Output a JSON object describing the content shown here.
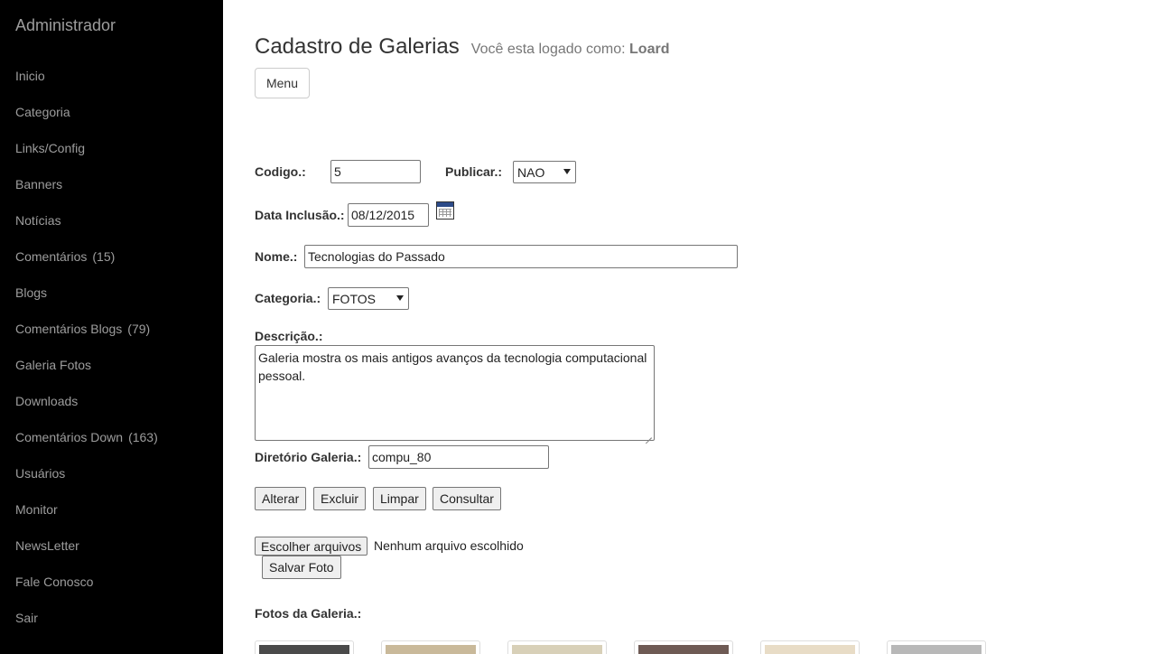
{
  "sidebar": {
    "brand": "Administrador",
    "items": [
      {
        "label": "Inicio",
        "badge": ""
      },
      {
        "label": "Categoria",
        "badge": ""
      },
      {
        "label": "Links/Config",
        "badge": ""
      },
      {
        "label": "Banners",
        "badge": ""
      },
      {
        "label": "Notícias",
        "badge": ""
      },
      {
        "label": "Comentários",
        "badge": "(15)"
      },
      {
        "label": "Blogs",
        "badge": ""
      },
      {
        "label": "Comentários Blogs",
        "badge": "(79)"
      },
      {
        "label": "Galeria Fotos",
        "badge": ""
      },
      {
        "label": "Downloads",
        "badge": ""
      },
      {
        "label": "Comentários Down",
        "badge": "(163)"
      },
      {
        "label": "Usuários",
        "badge": ""
      },
      {
        "label": "Monitor",
        "badge": ""
      },
      {
        "label": "NewsLetter",
        "badge": ""
      },
      {
        "label": "Fale Conosco",
        "badge": ""
      },
      {
        "label": "Sair",
        "badge": ""
      }
    ]
  },
  "header": {
    "title": "Cadastro de Galerias",
    "logged_prefix": "Você esta logado como:",
    "user": "Loard",
    "menu_label": "Menu"
  },
  "form": {
    "codigo_label": "Codigo.:",
    "codigo_value": "5",
    "publicar_label": "Publicar.:",
    "publicar_value": "NAO",
    "data_label": "Data Inclusão.:",
    "data_value": "08/12/2015",
    "calendar_icon": "calendar-icon",
    "nome_label": "Nome.:",
    "nome_value": "Tecnologias do Passado",
    "categoria_label": "Categoria.:",
    "categoria_value": "FOTOS",
    "descricao_label": "Descrição.:",
    "descricao_value": "Galeria mostra os mais antigos avanços da tecnologia computacional pessoal.",
    "diretorio_label": "Diretório Galeria.:",
    "diretorio_value": "compu_80"
  },
  "actions": {
    "alterar": "Alterar",
    "excluir": "Excluir",
    "limpar": "Limpar",
    "consultar": "Consultar"
  },
  "upload": {
    "choose_label": "Escolher arquivos",
    "status": "Nenhum arquivo escolhido",
    "save_label": "Salvar Foto"
  },
  "gallery": {
    "title": "Fotos da Galeria.:",
    "thumb_colors": [
      "#4a4a4a",
      "#c9b99a",
      "#d8d0b8",
      "#6e5a54",
      "#e8dcc6",
      "#b8b8b8"
    ]
  }
}
